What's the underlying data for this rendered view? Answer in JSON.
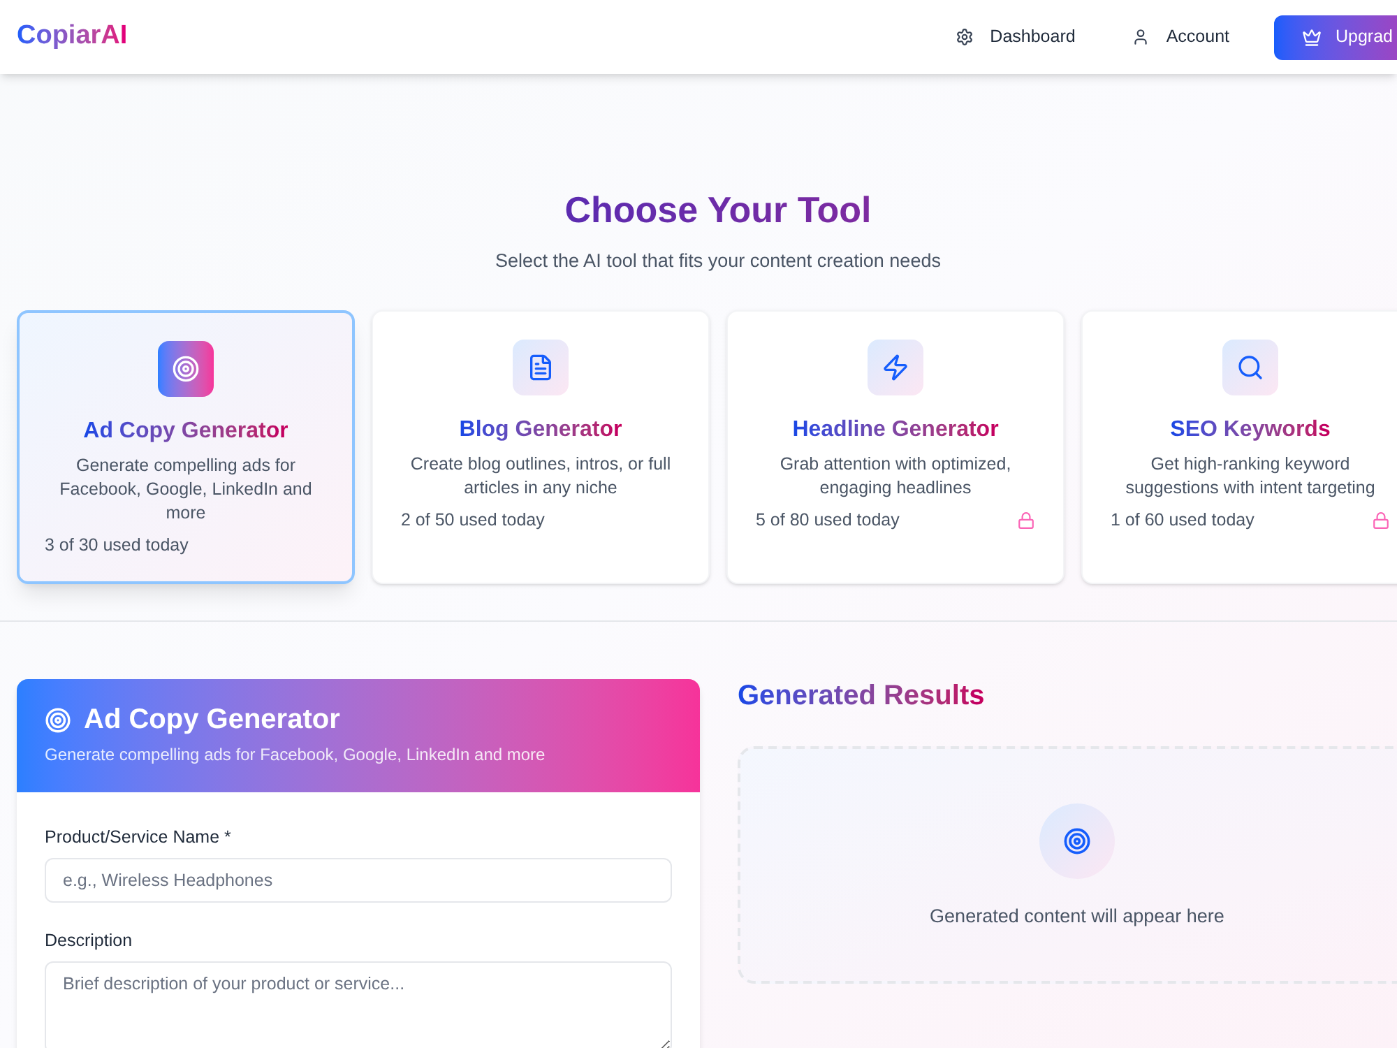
{
  "header": {
    "logo": "CopiarAI",
    "nav": [
      {
        "kind": "link",
        "label": "Dashboard"
      },
      {
        "kind": "link",
        "label": "Account"
      },
      {
        "kind": "button",
        "label": "Upgrad"
      }
    ]
  },
  "hero": {
    "title": "Choose Your Tool",
    "subtitle": "Select the AI tool that fits your content creation needs"
  },
  "tools": [
    {
      "title": "Ad Copy Generator",
      "description": "Generate compelling ads for Facebook, Google, LinkedIn and more",
      "usage": "3 of 30 used today",
      "selected": true,
      "locked": false
    },
    {
      "title": "Blog Generator",
      "description": "Create blog outlines, intros, or full articles in any niche",
      "usage": "2 of 50 used today",
      "selected": false,
      "locked": false
    },
    {
      "title": "Headline Generator",
      "description": "Grab attention with optimized, engaging headlines",
      "usage": "5 of 80 used today",
      "selected": false,
      "locked": true
    },
    {
      "title": "SEO Keywords",
      "description": "Get high-ranking keyword suggestions with intent targeting",
      "usage": "1 of 60 used today",
      "selected": false,
      "locked": true
    }
  ],
  "form": {
    "title": "Ad Copy Generator",
    "subtitle": "Generate compelling ads for Facebook, Google, LinkedIn and more",
    "fields": [
      {
        "kind": "input",
        "label": "Product/Service Name *",
        "placeholder": "e.g., Wireless Headphones"
      },
      {
        "kind": "textarea",
        "label": "Description",
        "placeholder": "Brief description of your product or service..."
      }
    ]
  },
  "results": {
    "title": "Generated Results",
    "empty_message": "Generated content will appear here"
  }
}
